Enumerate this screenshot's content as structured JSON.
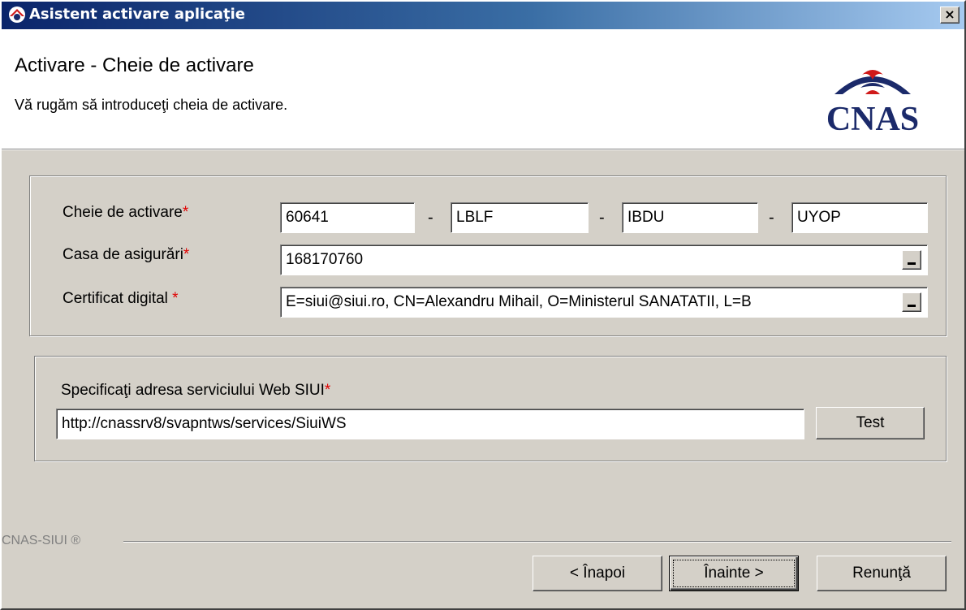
{
  "window": {
    "title": "Asistent activare aplicaţie",
    "close_glyph": "×"
  },
  "header": {
    "title": "Activare - Cheie de activare",
    "subtitle": "Vă rugăm să introduceţi cheia de activare.",
    "logo_text": "CNAS"
  },
  "form": {
    "activation_key": {
      "label": "Cheie de activare",
      "required_mark": "*",
      "separator": "-",
      "parts": [
        "60641",
        "LBLF",
        "IBDU",
        "UYOP"
      ]
    },
    "insurance_house": {
      "label": "Casa de asigurări",
      "required_mark": "*",
      "value": "168170760"
    },
    "digital_certificate": {
      "label": "Certificat digital",
      "required_mark": "*",
      "value": "E=siui@siui.ro, CN=Alexandru Mihail, O=Ministerul SANATATII, L=B"
    }
  },
  "web_service": {
    "label": "Specificaţi adresa serviciului Web SIUI",
    "required_mark": "*",
    "url": "http://cnassrv8/svapntws/services/SiuiWS",
    "test_label": "Test"
  },
  "footer": {
    "brand": "CNAS-SIUI ®",
    "back_label": "< Înapoi",
    "next_label": "Înainte >",
    "cancel_label": "Renunţă"
  },
  "colors": {
    "titlebar_start": "#0a246a",
    "titlebar_end": "#a6caf0",
    "dialog_bg": "#d4d0c8",
    "required": "#e00000",
    "logo_blue": "#1b2a6a",
    "logo_red": "#d01a1a"
  }
}
